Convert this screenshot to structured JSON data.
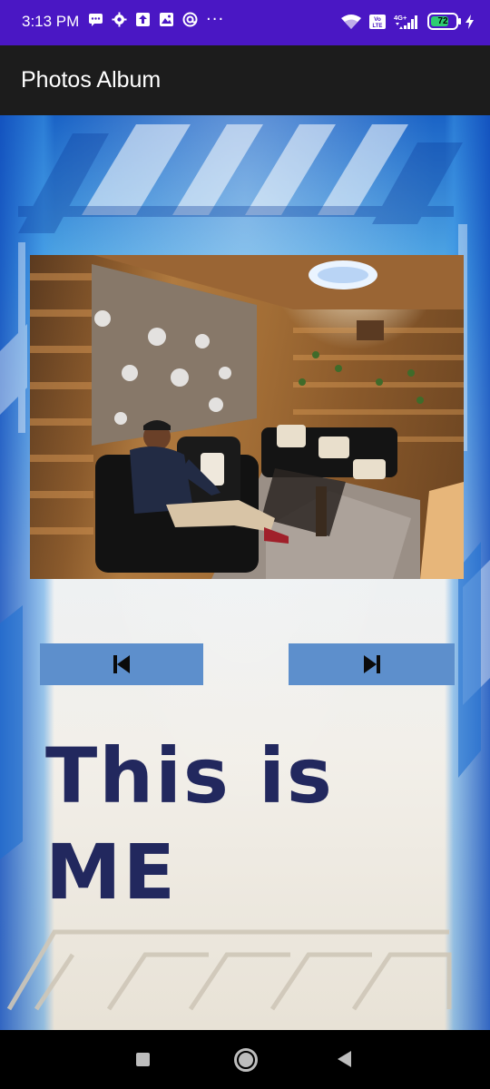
{
  "status_bar": {
    "time": "3:13 PM",
    "left_icons": [
      "message-icon",
      "gear-icon",
      "upload-icon",
      "photo-icon",
      "at-sign-icon"
    ],
    "overflow": "···",
    "right_icons": [
      "wifi-icon",
      "volte-icon",
      "signal-4g-icon"
    ],
    "network": "4G+",
    "volte": "Vo LTE",
    "battery": "72",
    "battery_level": 0.72,
    "charging": true
  },
  "app_bar": {
    "title": "Photos Album"
  },
  "main": {
    "photo": {
      "alt": "Man seated on black sofa in wood-paneled lounge"
    },
    "prev_button": {
      "icon": "skip-previous-icon"
    },
    "next_button": {
      "icon": "skip-next-icon"
    },
    "caption": "This is ME"
  },
  "nav_bar": {
    "items": [
      "recents-button",
      "home-button",
      "back-button"
    ]
  },
  "colors": {
    "status_bar": "#4a17c4",
    "app_bar": "#1c1c1c",
    "button": "#5d8fcc",
    "caption": "#22285e"
  }
}
